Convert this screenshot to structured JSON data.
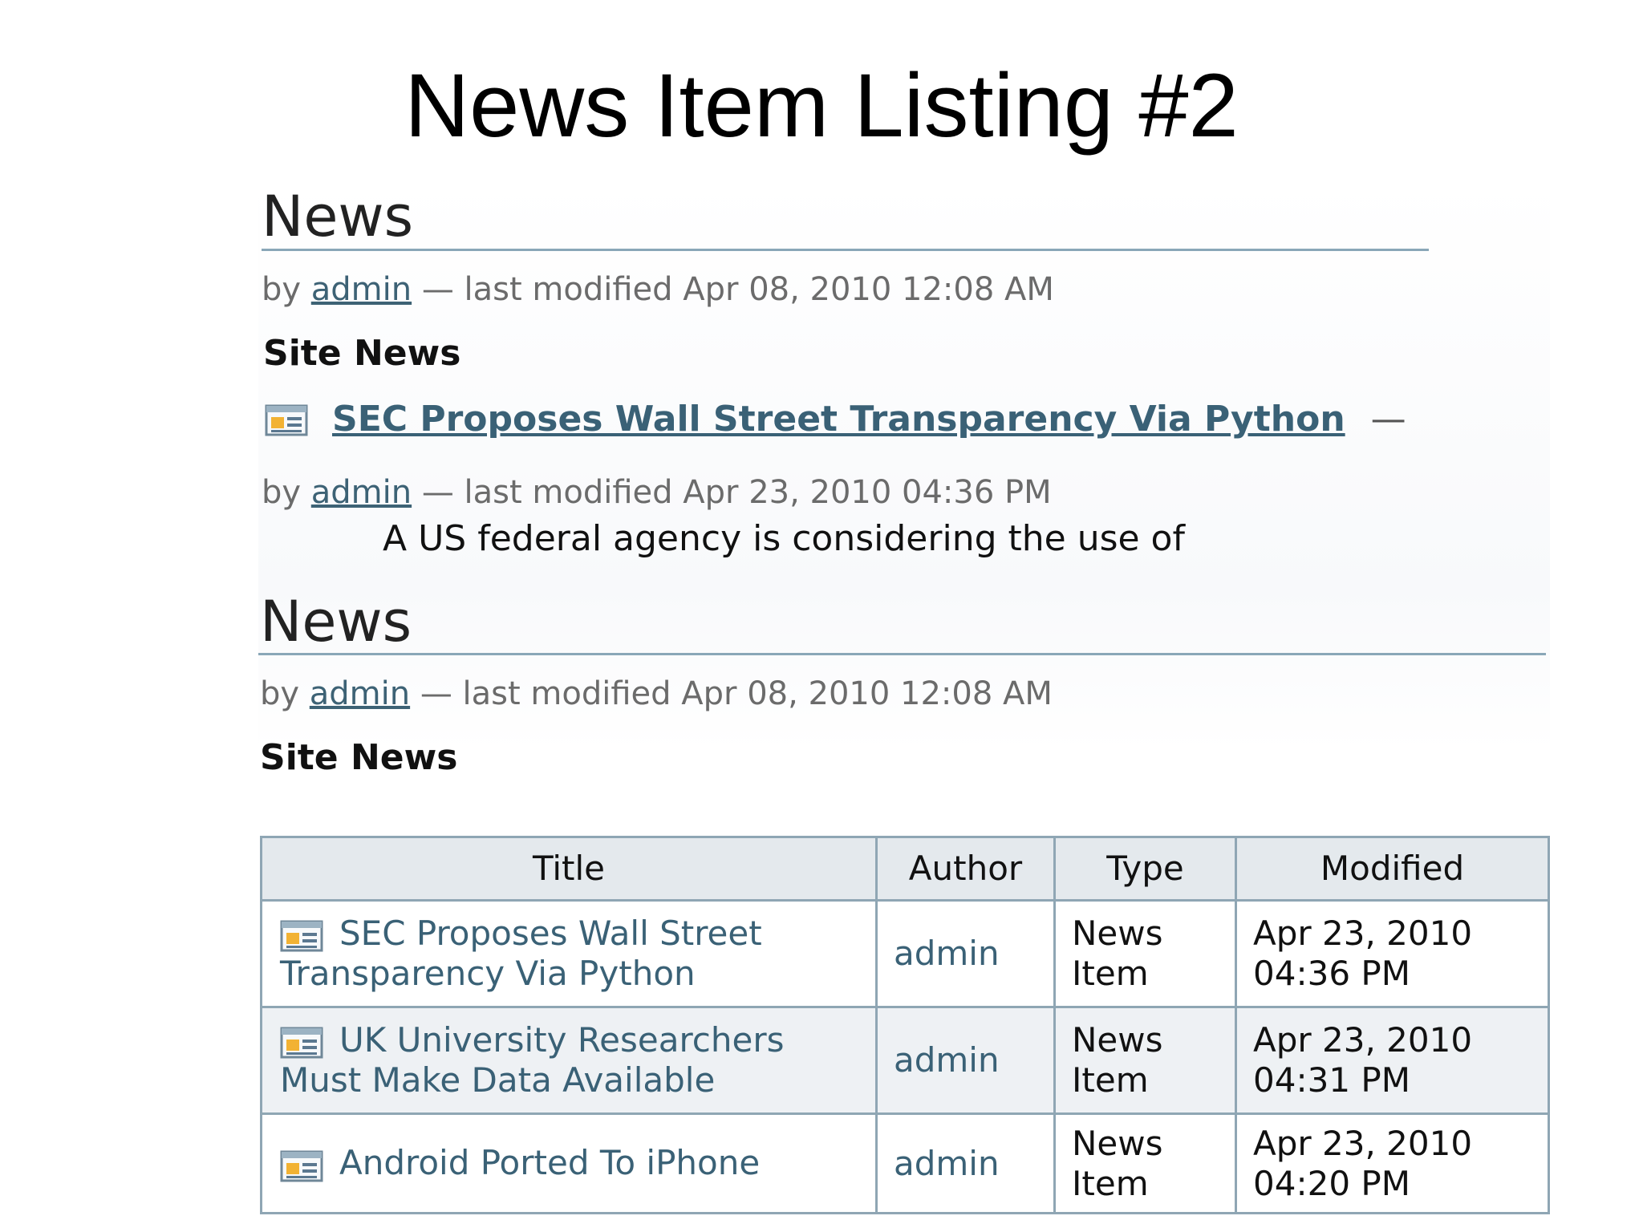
{
  "slide": {
    "title": "News Item Listing #2"
  },
  "summary_view": {
    "heading": "News",
    "byline": {
      "prefix": "by",
      "author": "admin",
      "suffix": "— last modified Apr 08, 2010 12:08 AM"
    },
    "description": "Site News",
    "item": {
      "icon": "news-item-icon",
      "title": "SEC Proposes Wall Street Transparency Via Python",
      "dash": "—",
      "byline": {
        "prefix": "by",
        "author": "admin",
        "suffix": "— last modified Apr 23, 2010 04:36 PM"
      },
      "description": "A US federal agency is considering the use of"
    }
  },
  "tabular_view": {
    "heading": "News",
    "byline": {
      "prefix": "by",
      "author": "admin",
      "suffix": "— last modified Apr 08, 2010 12:08 AM"
    },
    "description": "Site News",
    "columns": [
      "Title",
      "Author",
      "Type",
      "Modified"
    ],
    "rows": [
      {
        "title": "SEC Proposes Wall Street Transparency Via Python",
        "author": "admin",
        "type_line1": "News",
        "type_line2": "Item",
        "modified_date": "Apr 23, 2010",
        "modified_time": "04:36 PM"
      },
      {
        "title": "UK University Researchers Must Make Data Available",
        "author": "admin",
        "type_line1": "News",
        "type_line2": "Item",
        "modified_date": "Apr 23, 2010",
        "modified_time": "04:31 PM"
      },
      {
        "title": "Android Ported To iPhone",
        "author": "admin",
        "type_line1": "News",
        "type_line2": "Item",
        "modified_date": "Apr 23, 2010",
        "modified_time": "04:20 PM"
      }
    ],
    "icon": "news-item-icon"
  },
  "colors": {
    "link": "#3a6176",
    "rule": "#8aa7b8",
    "header_bg": "#e4e9ed",
    "row_alt_bg": "#eef1f4"
  }
}
